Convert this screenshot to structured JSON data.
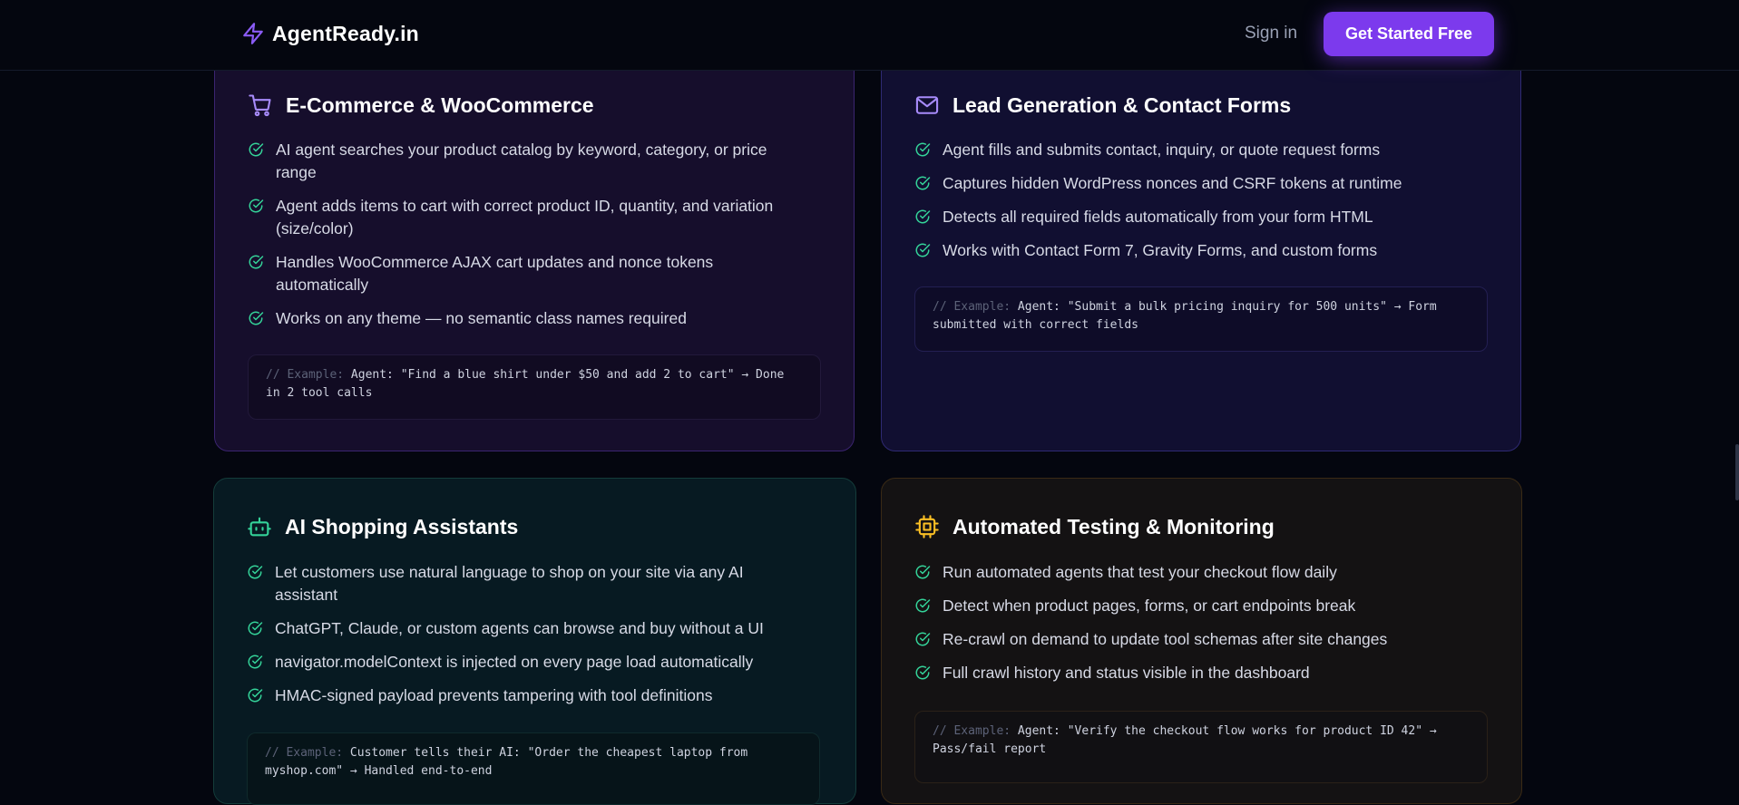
{
  "nav": {
    "brand": "AgentReady.in",
    "sign_in": "Sign in",
    "cta": "Get Started Free"
  },
  "colors": {
    "accent": "#7c3aed",
    "check": "#34d399",
    "background": "#04060f"
  },
  "cards": [
    {
      "icon": "shopping-cart-icon",
      "title": "E-Commerce & WooCommerce",
      "items": [
        "AI agent searches your product catalog by keyword, category, or price range",
        "Agent adds items to cart with correct product ID, quantity, and variation (size/color)",
        "Handles WooCommerce AJAX cart updates and nonce tokens automatically",
        "Works on any theme — no semantic class names required"
      ],
      "example_prefix": "// Example:",
      "example_text": "Agent: \"Find a blue shirt under $50 and add 2 to cart\" → Done in 2 tool calls"
    },
    {
      "icon": "mail-icon",
      "title": "Lead Generation & Contact Forms",
      "items": [
        "Agent fills and submits contact, inquiry, or quote request forms",
        "Captures hidden WordPress nonces and CSRF tokens at runtime",
        "Detects all required fields automatically from your form HTML",
        "Works with Contact Form 7, Gravity Forms, and custom forms"
      ],
      "example_prefix": "// Example:",
      "example_text": "Agent: \"Submit a bulk pricing inquiry for 500 units\" → Form submitted with correct fields"
    },
    {
      "icon": "bot-icon",
      "title": "AI Shopping Assistants",
      "items": [
        "Let customers use natural language to shop on your site via any AI assistant",
        "ChatGPT, Claude, or custom agents can browse and buy without a UI",
        "navigator.modelContext is injected on every page load automatically",
        "HMAC-signed payload prevents tampering with tool definitions"
      ],
      "example_prefix": "// Example:",
      "example_text": "Customer tells their AI: \"Order the cheapest laptop from myshop.com\" → Handled end-to-end"
    },
    {
      "icon": "chip-icon",
      "title": "Automated Testing & Monitoring",
      "items": [
        "Run automated agents that test your checkout flow daily",
        "Detect when product pages, forms, or cart endpoints break",
        "Re-crawl on demand to update tool schemas after site changes",
        "Full crawl history and status visible in the dashboard"
      ],
      "example_prefix": "// Example:",
      "example_text": "Agent: \"Verify the checkout flow works for product ID 42\" → Pass/fail report"
    }
  ]
}
